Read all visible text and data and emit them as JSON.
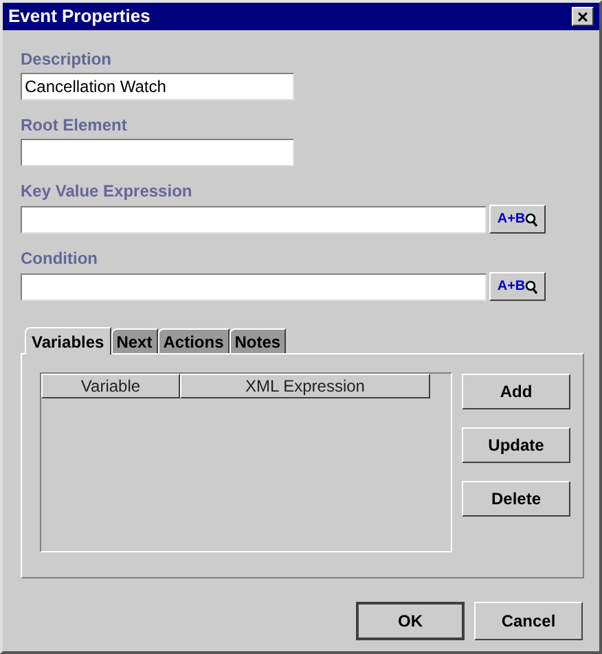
{
  "window": {
    "title": "Event Properties",
    "close": "×"
  },
  "fields": [
    {
      "label": "Description",
      "value": "Cancellation Watch"
    },
    {
      "label": "Root Element"
    },
    {
      "label": "Key Value Expression",
      "builder": "A+B"
    },
    {
      "label": "Condition",
      "builder": "A+B"
    }
  ],
  "tabs": [
    {
      "label": "Variables",
      "selected": true
    },
    {
      "label": "Next",
      "selected": false
    },
    {
      "label": "Actions",
      "selected": false
    },
    {
      "label": "Notes",
      "selected": false
    }
  ],
  "table": {
    "columns": [
      "Variable",
      "XML Expression"
    ]
  },
  "side_buttons": [
    "Add",
    "Update",
    "Delete"
  ],
  "buttons": [
    {
      "label": "OK",
      "default": true
    },
    {
      "label": "Cancel",
      "default": false
    }
  ]
}
